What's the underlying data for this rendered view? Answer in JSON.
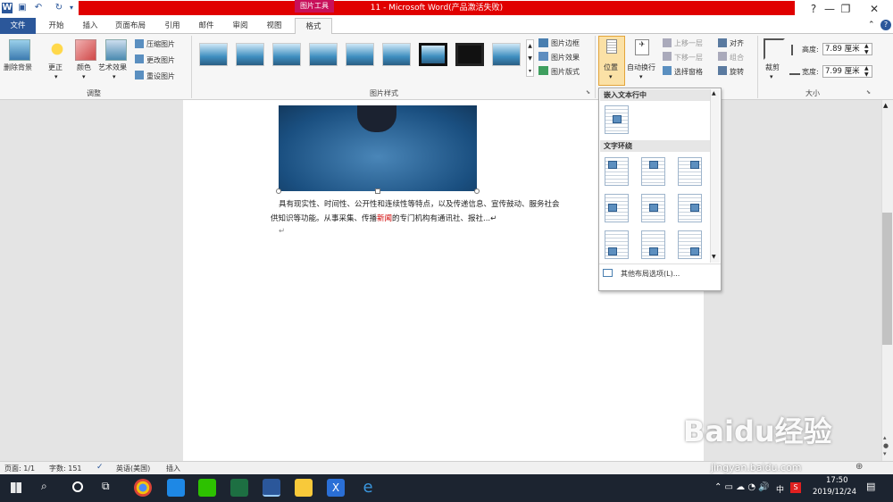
{
  "titlebar": {
    "picture_tools": "图片工具",
    "title": "11  -  Microsoft Word(产品激活失败)"
  },
  "tabs": [
    "文件",
    "开始",
    "插入",
    "页面布局",
    "引用",
    "邮件",
    "审阅",
    "视图",
    "格式"
  ],
  "ribbon": {
    "adjust": {
      "remove_bg": "删除背景",
      "correct": "更正",
      "color": "颜色",
      "art_effects": "艺术效果",
      "compress": "压缩图片",
      "change": "更改图片",
      "reset": "重设图片",
      "group_label": "调整"
    },
    "styles": {
      "border": "图片边框",
      "effects": "图片效果",
      "layout": "图片版式",
      "group_label": "图片样式"
    },
    "arrange": {
      "position": "位置",
      "wrap": "自动换行",
      "bring_forward": "上移一层",
      "send_backward": "下移一层",
      "selection_pane": "选择窗格",
      "align": "对齐",
      "group": "组合",
      "rotate": "旋转"
    },
    "size": {
      "crop": "裁剪",
      "height_label": "高度:",
      "height_value": "7.89 厘米",
      "width_label": "宽度:",
      "width_value": "7.99 厘米",
      "group_label": "大小"
    }
  },
  "document": {
    "line1": "具有现实性、时间性、公开性和连续性等特点，以及传递信息、宣传鼓动、服务社会",
    "line2_a": "供知识等功能。从事采集、传播",
    "line2_highlight": "新闻",
    "line2_b": "的专门机构有通讯社、报社...↵",
    "para_mark": "↵"
  },
  "position_menu": {
    "inline_header": "嵌入文本行中",
    "wrap_header": "文字环绕",
    "more_options": "其他布局选项(L)..."
  },
  "status": {
    "page": "页面: 1/1",
    "words": "字数: 151",
    "language": "英语(美国)",
    "mode": "插入"
  },
  "taskbar": {
    "time": "17:50",
    "date": "2019/12/24",
    "ime": "中"
  },
  "watermark": {
    "brand": "Baidu经验",
    "url": "jingyan.baidu.com"
  }
}
